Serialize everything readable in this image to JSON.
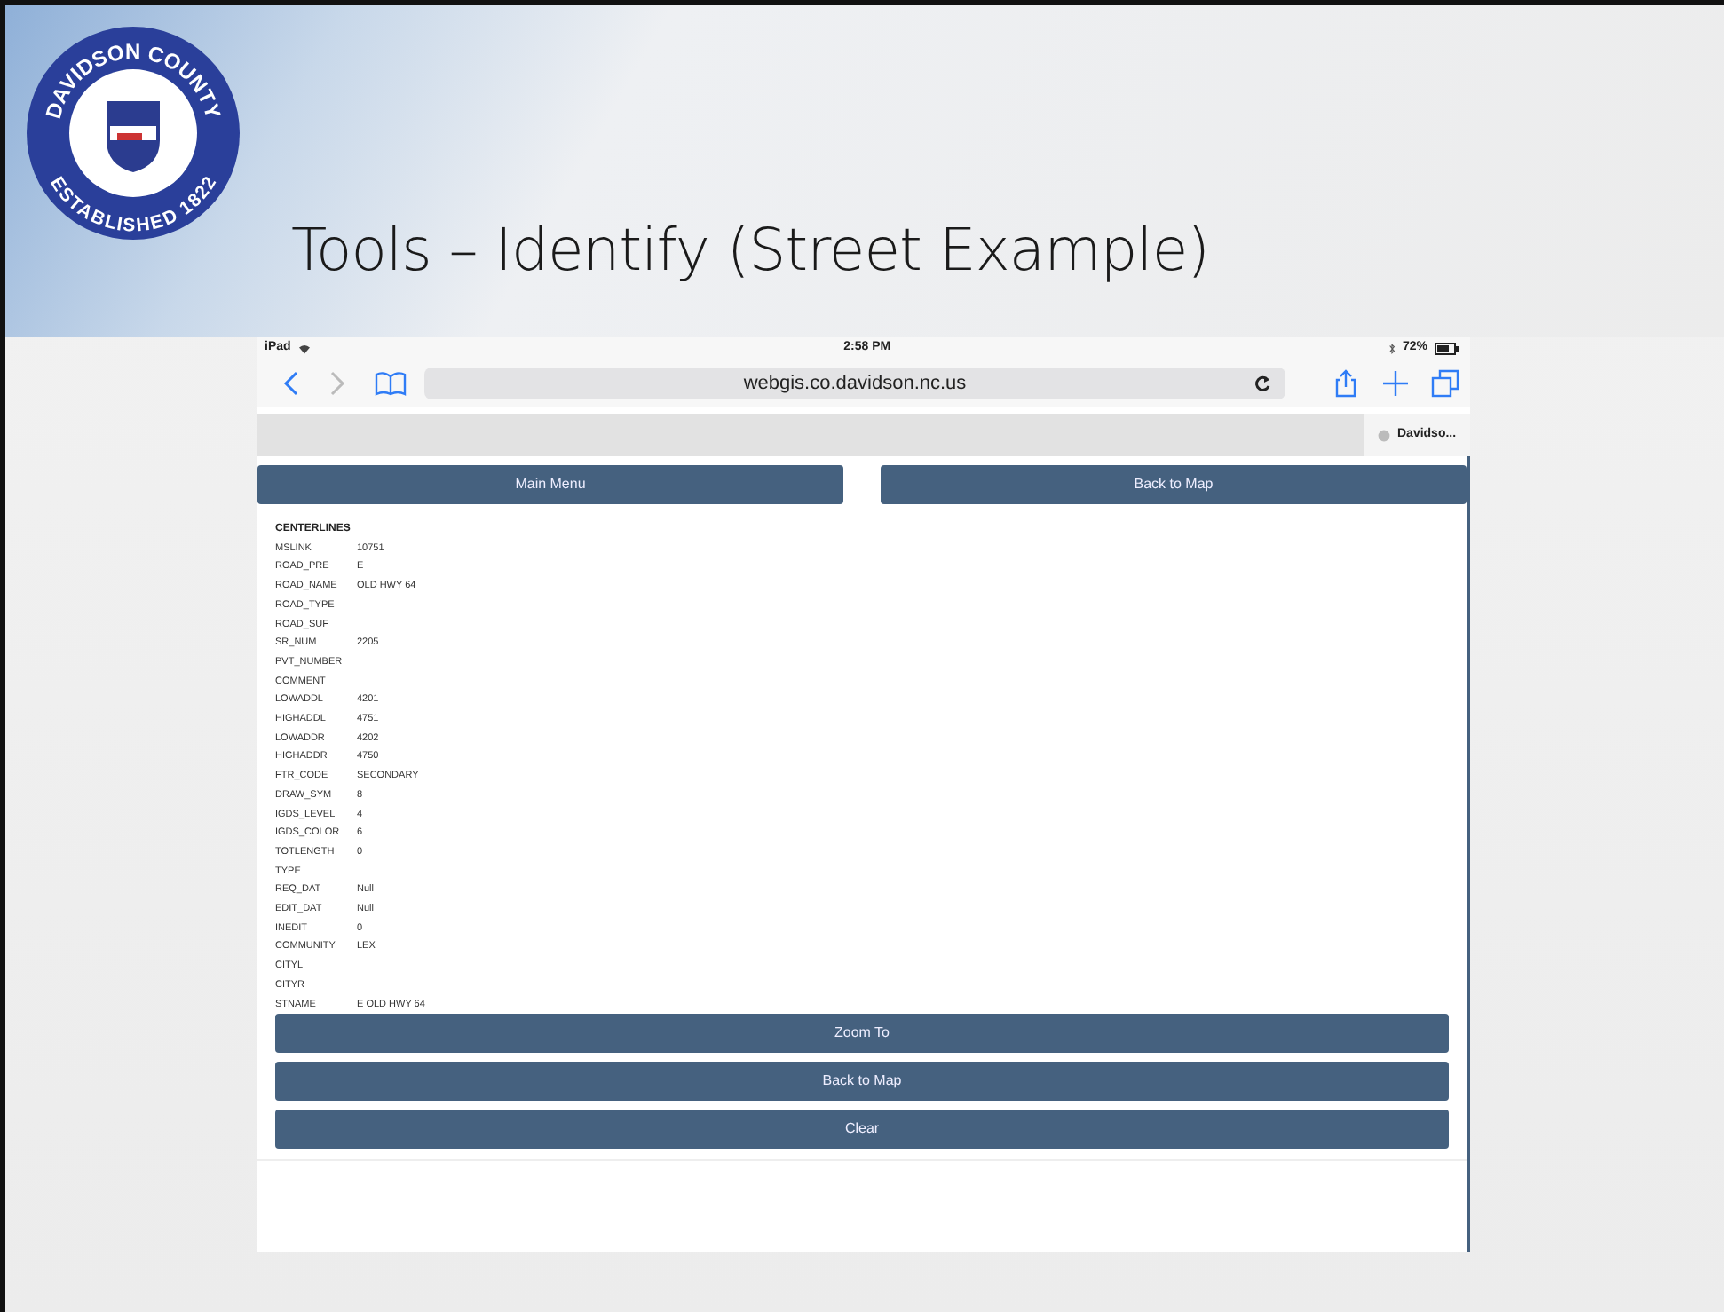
{
  "slide": {
    "title": "Tools – Identify (Street Example)",
    "logo": {
      "top_text": "DAVIDSON COUNTY",
      "bottom_text": "ESTABLISHED 1822"
    }
  },
  "status_bar": {
    "device": "iPad",
    "time": "2:58 PM",
    "battery": "72%"
  },
  "browser": {
    "url": "webgis.co.davidson.nc.us",
    "back_enabled": true,
    "forward_enabled": false,
    "tabs": [
      {
        "label": "Davidso...",
        "selected": true
      }
    ]
  },
  "top_buttons": [
    "Main Menu",
    "Back to Map"
  ],
  "identify": {
    "layer": "CENTERLINES",
    "fields": [
      {
        "name": "MSLINK",
        "value": "10751"
      },
      {
        "name": "ROAD_PRE",
        "value": "E"
      },
      {
        "name": "ROAD_NAME",
        "value": "OLD HWY 64"
      },
      {
        "name": "ROAD_TYPE"
      },
      {
        "name": "ROAD_SUF"
      },
      {
        "name": "SR_NUM",
        "value": "2205"
      },
      {
        "name": "PVT_NUMBER"
      },
      {
        "name": "COMMENT"
      },
      {
        "name": "LOWADDL",
        "value": "4201"
      },
      {
        "name": "HIGHADDL",
        "value": "4751"
      },
      {
        "name": "LOWADDR",
        "value": "4202"
      },
      {
        "name": "HIGHADDR",
        "value": "4750"
      },
      {
        "name": "FTR_CODE",
        "value": "SECONDARY"
      },
      {
        "name": "DRAW_SYM",
        "value": "8"
      },
      {
        "name": "IGDS_LEVEL",
        "value": "4"
      },
      {
        "name": "IGDS_COLOR",
        "value": "6"
      },
      {
        "name": "TOTLENGTH",
        "value": "0"
      },
      {
        "name": "TYPE"
      },
      {
        "name": "REQ_DAT",
        "value": "Null"
      },
      {
        "name": "EDIT_DAT",
        "value": "Null"
      },
      {
        "name": "INEDIT",
        "value": "0"
      },
      {
        "name": "COMMUNITY",
        "value": "LEX"
      },
      {
        "name": "CITYL"
      },
      {
        "name": "CITYR"
      },
      {
        "name": "STNAME",
        "value": "E OLD HWY 64"
      }
    ]
  },
  "action_buttons": [
    "Zoom To",
    "Back to Map",
    "Clear"
  ]
}
